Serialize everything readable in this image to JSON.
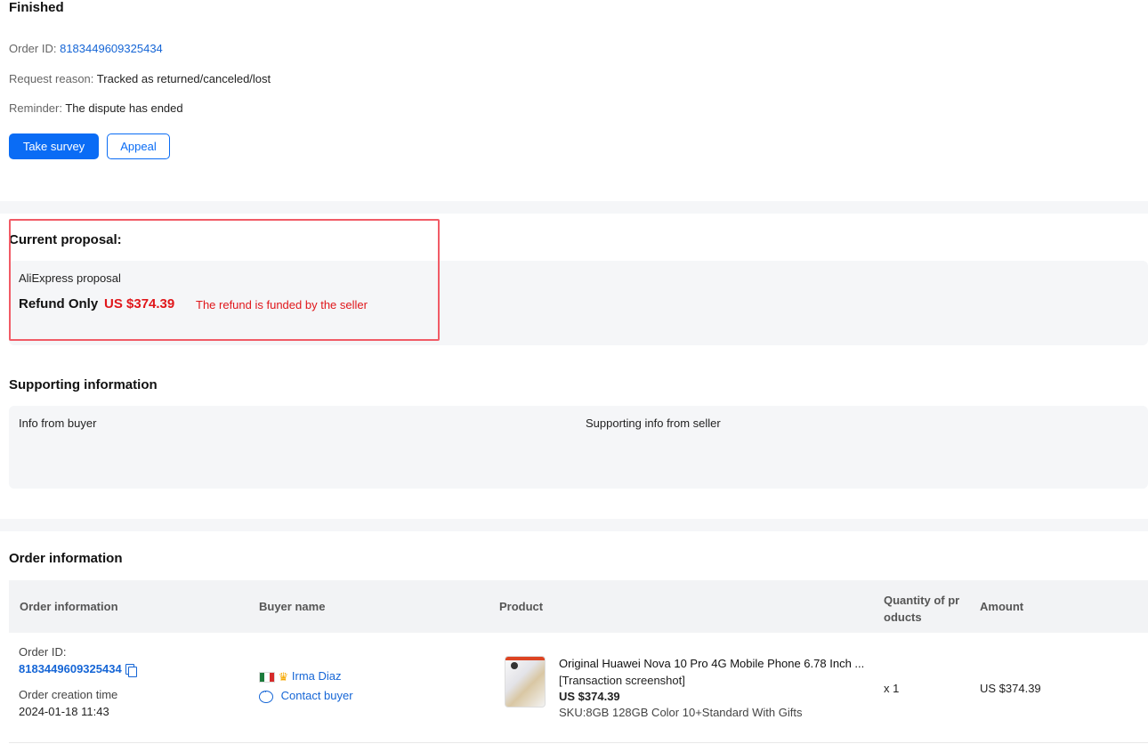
{
  "status": {
    "title": "Finished",
    "order_id_label": "Order ID:",
    "order_id": "8183449609325434",
    "request_reason_label": "Request reason:",
    "request_reason": "Tracked as returned/canceled/lost",
    "reminder_label": "Reminder:",
    "reminder": "The dispute has ended",
    "survey_button": "Take survey",
    "appeal_button": "Appeal"
  },
  "proposal": {
    "title": "Current proposal:",
    "source": "AliExpress proposal",
    "type": "Refund Only",
    "amount": "US $374.39",
    "note": "The refund is funded by the seller"
  },
  "supporting": {
    "title": "Supporting information",
    "buyer_label": "Info from buyer",
    "seller_label": "Supporting info from seller"
  },
  "order": {
    "title": "Order information",
    "columns": [
      "Order information",
      "Buyer name",
      "Product",
      "Quantity of pr",
      "oducts",
      "Amount"
    ],
    "row": {
      "order_id_label": "Order ID:",
      "order_id": "8183449609325434",
      "creation_label": "Order creation time",
      "creation_time": "2024-01-18 11:43",
      "buyer_name": "Irma Diaz",
      "contact": "Contact buyer",
      "product_title": "Original Huawei Nova 10 Pro 4G Mobile Phone 6.78 Inch ...",
      "transaction_link": "[Transaction screenshot]",
      "product_price": "US $374.39",
      "sku": "SKU:8GB 128GB Color 10+Standard With Gifts",
      "quantity": "x 1",
      "amount": "US $374.39"
    }
  },
  "colors": {
    "primary": "#0a6cf5",
    "link": "#1666d6",
    "danger": "#e0171b",
    "highlight": "#f15b66"
  },
  "icons": [
    "copy-icon",
    "mexico-flag-icon",
    "crown-icon",
    "chat-icon"
  ]
}
